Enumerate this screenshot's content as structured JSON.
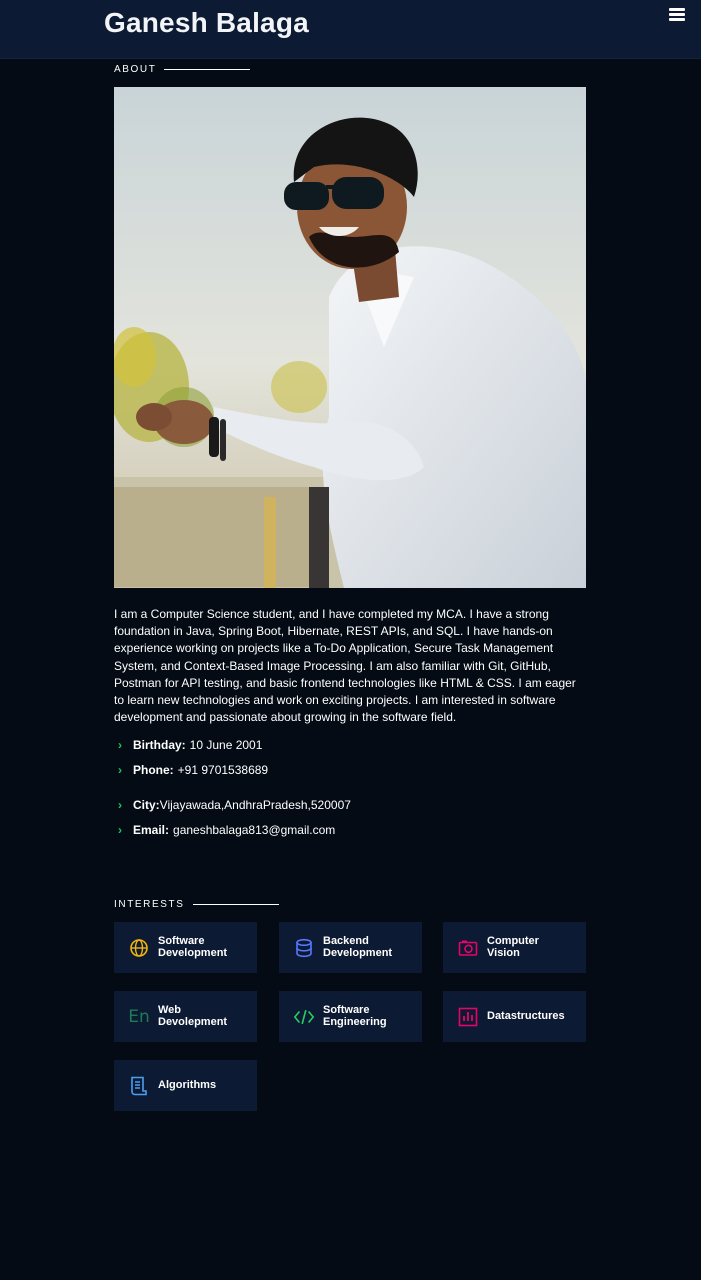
{
  "header": {
    "title": "Ganesh Balaga",
    "menu_icon": "hamburger-icon"
  },
  "about": {
    "heading": "ABOUT",
    "photo_alt": "Ganesh Balaga",
    "description": "I am a Computer Science student, and I have completed my MCA. I have a strong foundation in Java, Spring Boot, Hibernate, REST APIs, and SQL. I have hands-on experience working on projects like a To-Do Application, Secure Task Management System, and Context-Based Image Processing. I am also familiar with Git, GitHub, Postman for API testing, and basic frontend technologies like HTML & CSS. I am eager to learn new technologies and work on exciting projects. I am interested in software development and passionate about growing in the software field.",
    "details": [
      {
        "label": "Birthday:",
        "value": "10 June 2001"
      },
      {
        "label": "Phone:",
        "value": "+91 9701538689"
      },
      {
        "label": "City:",
        "value": "Vijayawada,AndhraPradesh,520007"
      },
      {
        "label": "Email:",
        "value": "ganeshbalaga813@gmail.com"
      }
    ]
  },
  "interests": {
    "heading": "INTERESTS",
    "items": [
      {
        "line1": "Software",
        "line2": "Development",
        "icon": "globe-icon",
        "color": "#f5b50a"
      },
      {
        "line1": "Backend",
        "line2": "Development",
        "icon": "database-icon",
        "color": "#5578ff"
      },
      {
        "line1": "Computer",
        "line2": "Vision",
        "icon": "camera-icon",
        "color": "#e80368"
      },
      {
        "line1": "Web",
        "line2": "Devolepment",
        "icon": "en-icon",
        "color": "#1c7c54"
      },
      {
        "line1": "Software",
        "line2": "Engineering",
        "icon": "code-icon",
        "color": "#29cc61"
      },
      {
        "line1": "Datastructures",
        "line2": "",
        "icon": "bar-chart-icon",
        "color": "#e80368"
      },
      {
        "line1": "Algorithms",
        "line2": "",
        "icon": "document-icon",
        "color": "#4b9ff1"
      }
    ]
  }
}
